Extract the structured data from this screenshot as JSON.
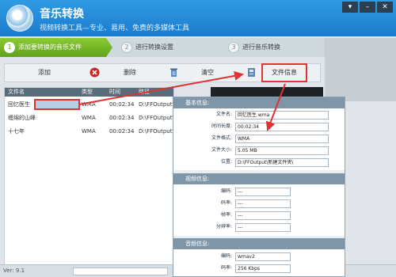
{
  "app": {
    "title": "音乐转换",
    "subtitle": "视频转换工具—专业、易用、免费的多媒体工具"
  },
  "window_controls": [
    "▾",
    "–",
    "✕"
  ],
  "steps": [
    {
      "num": "1",
      "label": "添加要转换的音乐文件"
    },
    {
      "num": "2",
      "label": "进行转换设置"
    },
    {
      "num": "3",
      "label": "进行音乐转换"
    }
  ],
  "toolbar": {
    "add_label": "添加",
    "delete_label": "删除",
    "clear_label": "清空",
    "file_info_label": "文件信息"
  },
  "table": {
    "columns": [
      "文件名",
      "类型",
      "时间",
      "路径"
    ],
    "rows": [
      {
        "name": "回忆医生",
        "type": "WMA",
        "time": "00:02:34",
        "path": "D:\\FFOutput\\"
      },
      {
        "name": "缠绵的山峰",
        "type": "WMA",
        "time": "00:02:34",
        "path": "D:\\FFOutput\\"
      },
      {
        "name": "十七年",
        "type": "WMA",
        "time": "00:02:34",
        "path": "D:\\FFOutput\\"
      }
    ]
  },
  "dialog": {
    "close": "✕",
    "basic": {
      "title": "基本信息:",
      "fields": [
        {
          "label": "文件名:",
          "value": "回忆医生.wma"
        },
        {
          "label": "时间长度:",
          "value": "00:02:34"
        },
        {
          "label": "文件格式:",
          "value": "WMA"
        },
        {
          "label": "文件大小:",
          "value": "5.05 MB"
        },
        {
          "label": "位置:",
          "value": "D:\\FFOutput\\新建文件夹\\"
        }
      ]
    },
    "video": {
      "title": "视频信息:",
      "fields": [
        {
          "label": "编码:",
          "value": "---"
        },
        {
          "label": "码率:",
          "value": "---"
        },
        {
          "label": "帧率:",
          "value": "---"
        },
        {
          "label": "分辨率:",
          "value": "---"
        }
      ]
    },
    "audio": {
      "title": "音频信息:",
      "fields": [
        {
          "label": "编码:",
          "value": "wmav2"
        },
        {
          "label": "码率:",
          "value": "256 Kbps"
        }
      ]
    }
  },
  "status": {
    "version": "Ver: 9.1"
  },
  "colors": {
    "header": "#1b7ccd",
    "active_step": "#6fb324",
    "highlight": "#dd3333"
  }
}
